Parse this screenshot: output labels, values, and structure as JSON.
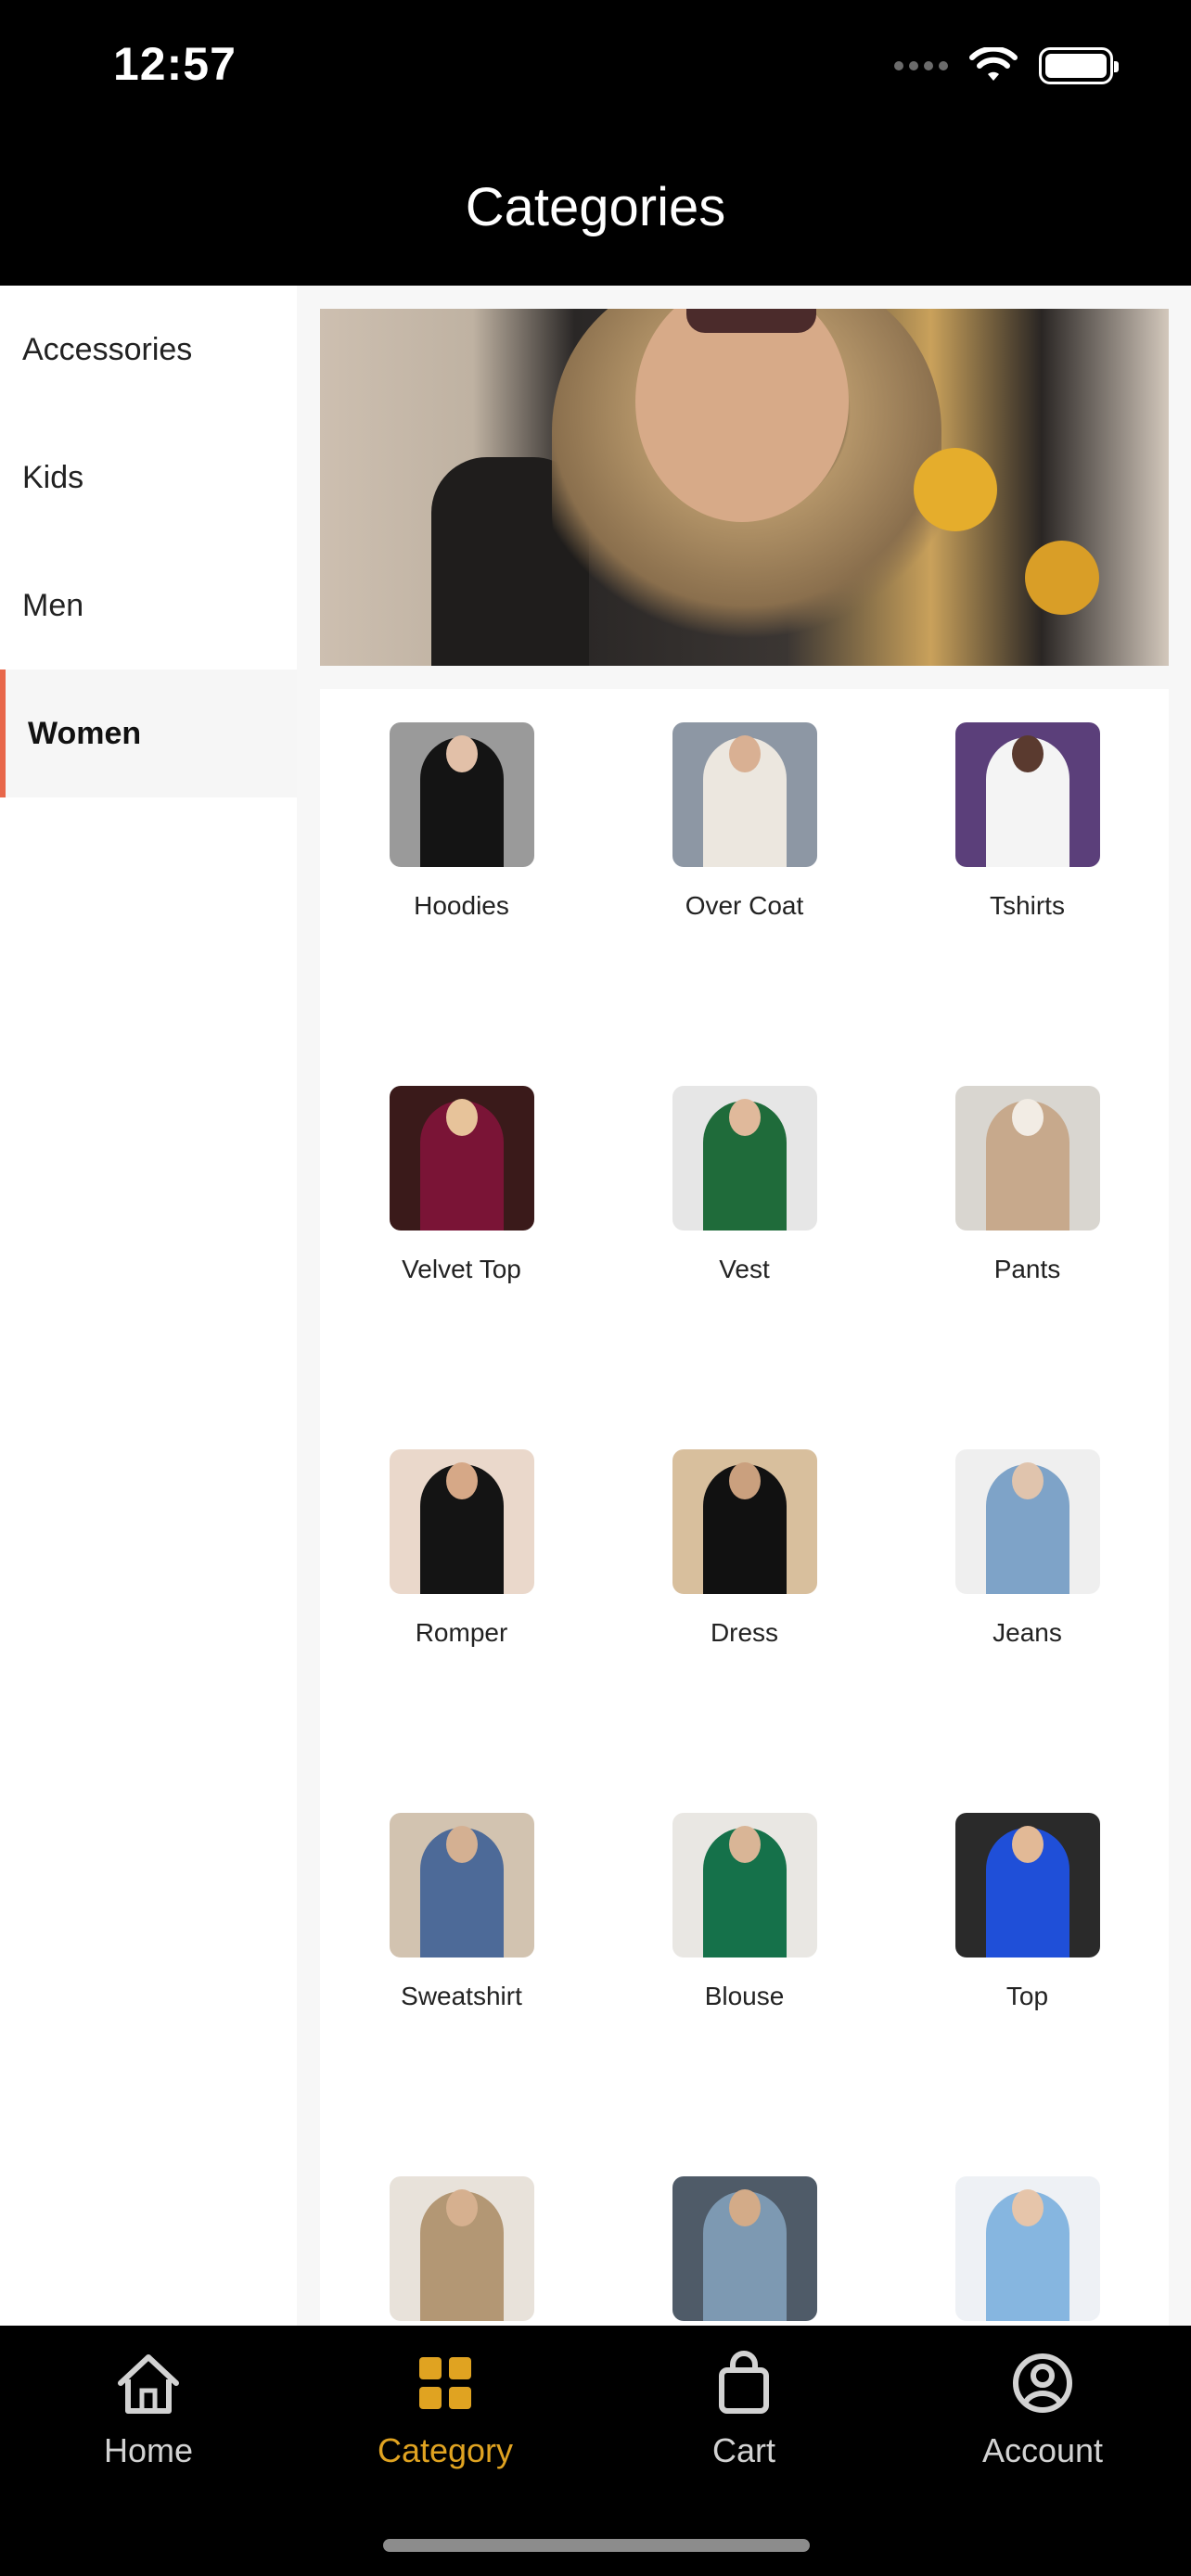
{
  "status_bar": {
    "time": "12:57"
  },
  "header": {
    "title": "Categories"
  },
  "sidebar": {
    "items": [
      {
        "label": "Accessories",
        "active": false
      },
      {
        "label": "Kids",
        "active": false
      },
      {
        "label": "Men",
        "active": false
      },
      {
        "label": "Women",
        "active": true
      }
    ]
  },
  "categories": [
    {
      "label": "Hoodies",
      "bg": "#9a9a9a",
      "color": "#141414",
      "skin": "#e2c0a8"
    },
    {
      "label": "Over Coat",
      "bg": "#8d97a4",
      "color": "#ece7df",
      "skin": "#d9b093"
    },
    {
      "label": "Tshirts",
      "bg": "#5b3f7a",
      "color": "#f4f4f4",
      "skin": "#5a3a2f"
    },
    {
      "label": "Velvet Top",
      "bg": "#3a1a1a",
      "color": "#7a1436",
      "skin": "#e7c39a"
    },
    {
      "label": "Vest",
      "bg": "#e6e6e6",
      "color": "#1f6b3a",
      "skin": "#e0b99b"
    },
    {
      "label": "Pants",
      "bg": "#d9d6d0",
      "color": "#c7a98c",
      "skin": "#f2ece4"
    },
    {
      "label": "Romper",
      "bg": "#ead8cb",
      "color": "#141414",
      "skin": "#d6a887"
    },
    {
      "label": "Dress",
      "bg": "#d8bf9d",
      "color": "#111111",
      "skin": "#caa07e"
    },
    {
      "label": "Jeans",
      "bg": "#efefef",
      "color": "#7ea3c8",
      "skin": "#e0c4ad"
    },
    {
      "label": "Sweatshirt",
      "bg": "#d2c3b0",
      "color": "#4d6a98",
      "skin": "#d4b092"
    },
    {
      "label": "Blouse",
      "bg": "#e9e7e3",
      "color": "#15714a",
      "skin": "#d9b596"
    },
    {
      "label": "Top",
      "bg": "#2a2a2a",
      "color": "#1f4fd8",
      "skin": "#e2b996"
    },
    {
      "label": "",
      "bg": "#e8e2da",
      "color": "#b39774",
      "skin": "#d6b08f"
    },
    {
      "label": "",
      "bg": "#4f5b68",
      "color": "#7d99b2",
      "skin": "#d3ab88"
    },
    {
      "label": "",
      "bg": "#eef1f5",
      "color": "#86b6e0",
      "skin": "#e6c5aa"
    }
  ],
  "tabbar": {
    "items": [
      {
        "label": "Home",
        "icon": "home-icon",
        "active": false
      },
      {
        "label": "Category",
        "icon": "grid-icon",
        "active": true
      },
      {
        "label": "Cart",
        "icon": "bag-icon",
        "active": false
      },
      {
        "label": "Account",
        "icon": "account-icon",
        "active": false
      }
    ]
  },
  "colors": {
    "accent": "#e0a321",
    "sidebar_active_marker": "#e8674a"
  }
}
